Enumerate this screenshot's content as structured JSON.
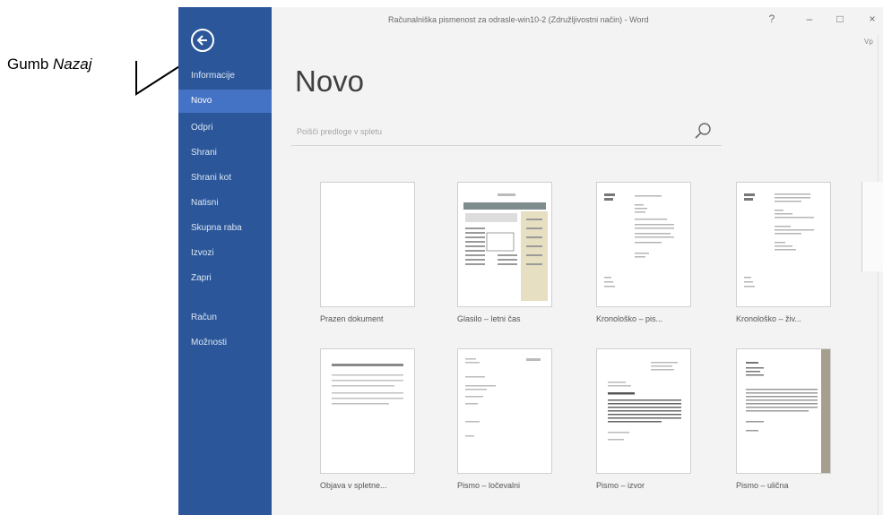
{
  "annotation": {
    "prefix": "Gumb ",
    "emph": "Nazaj"
  },
  "window": {
    "title": "Računalniška pismenost za odrasle-win10-2 (Združljivostni način) - Word",
    "help": "?",
    "minimize": "–",
    "restore": "□",
    "close": "×",
    "signin": "Vp"
  },
  "sidebar": {
    "items": [
      {
        "label": "Informacije"
      },
      {
        "label": "Novo"
      },
      {
        "label": "Odpri"
      },
      {
        "label": "Shrani"
      },
      {
        "label": "Shrani kot"
      },
      {
        "label": "Natisni"
      },
      {
        "label": "Skupna raba"
      },
      {
        "label": "Izvozi"
      },
      {
        "label": "Zapri"
      },
      {
        "label": "Račun"
      },
      {
        "label": "Možnosti"
      }
    ],
    "active_index": 1
  },
  "main": {
    "title": "Novo",
    "search": {
      "placeholder": "Poišči predloge v spletu"
    },
    "templates": [
      {
        "label": "Prazen dokument"
      },
      {
        "label": "Glasilo – letni čas"
      },
      {
        "label": "Kronološko – pis..."
      },
      {
        "label": "Kronološko – živ..."
      },
      {
        "label": "Objava v spletne..."
      },
      {
        "label": "Pismo – ločevalni"
      },
      {
        "label": "Pismo – izvor"
      },
      {
        "label": "Pismo – ulična"
      }
    ]
  },
  "colors": {
    "sidebar": "#2b579a",
    "sidebar_active": "#4472c4",
    "main_bg": "#f3f3f3"
  }
}
